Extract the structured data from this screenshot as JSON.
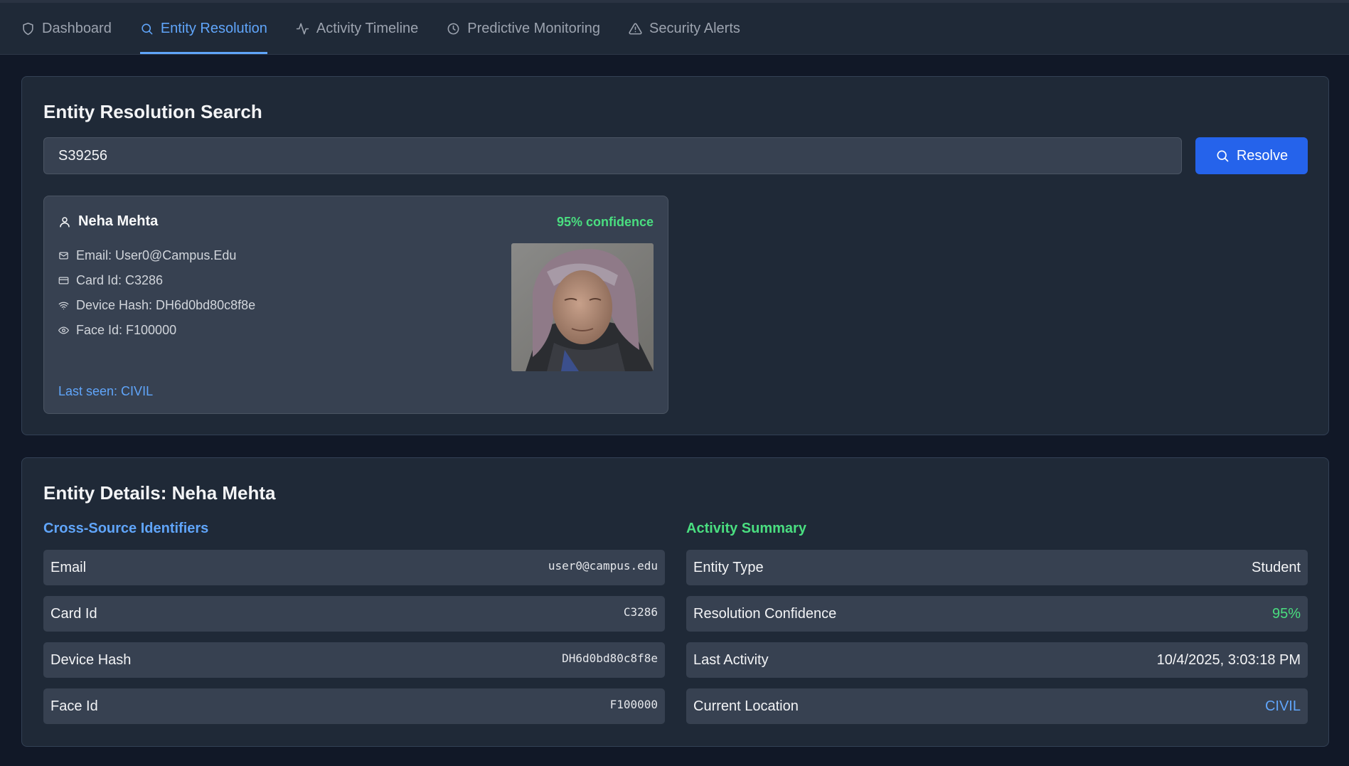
{
  "nav": {
    "tabs": [
      {
        "label": "Dashboard",
        "icon": "shield-icon"
      },
      {
        "label": "Entity Resolution",
        "icon": "search-icon",
        "active": true
      },
      {
        "label": "Activity Timeline",
        "icon": "activity-icon"
      },
      {
        "label": "Predictive Monitoring",
        "icon": "clock-icon"
      },
      {
        "label": "Security Alerts",
        "icon": "alert-triangle-icon"
      }
    ]
  },
  "search": {
    "title": "Entity Resolution Search",
    "value": "S39256",
    "button_label": "Resolve"
  },
  "result_card": {
    "name": "Neha Mehta",
    "confidence": "95% confidence",
    "fields": [
      {
        "icon": "mail-icon",
        "text": "Email: User0@Campus.Edu"
      },
      {
        "icon": "card-icon",
        "text": "Card Id: C3286"
      },
      {
        "icon": "wifi-icon",
        "text": "Device Hash: DH6d0bd80c8f8e"
      },
      {
        "icon": "eye-icon",
        "text": "Face Id: F100000"
      }
    ],
    "last_seen": "Last seen: CIVIL",
    "photo": "face-photo"
  },
  "details": {
    "title": "Entity Details: Neha Mehta",
    "identifiers_title": "Cross-Source Identifiers",
    "identifiers": [
      {
        "label": "Email",
        "value": "user0@campus.edu"
      },
      {
        "label": "Card Id",
        "value": "C3286"
      },
      {
        "label": "Device Hash",
        "value": "DH6d0bd80c8f8e"
      },
      {
        "label": "Face Id",
        "value": "F100000"
      }
    ],
    "summary_title": "Activity Summary",
    "summary": [
      {
        "label": "Entity Type",
        "value": "Student"
      },
      {
        "label": "Resolution Confidence",
        "value": "95%"
      },
      {
        "label": "Last Activity",
        "value": "10/4/2025, 3:03:18 PM"
      },
      {
        "label": "Current Location",
        "value": "CIVIL"
      }
    ]
  },
  "colors": {
    "accent_blue": "#60a5fa",
    "accent_green": "#4ade80",
    "button_blue": "#2563eb",
    "background": "#111827",
    "panel": "#1f2937"
  }
}
